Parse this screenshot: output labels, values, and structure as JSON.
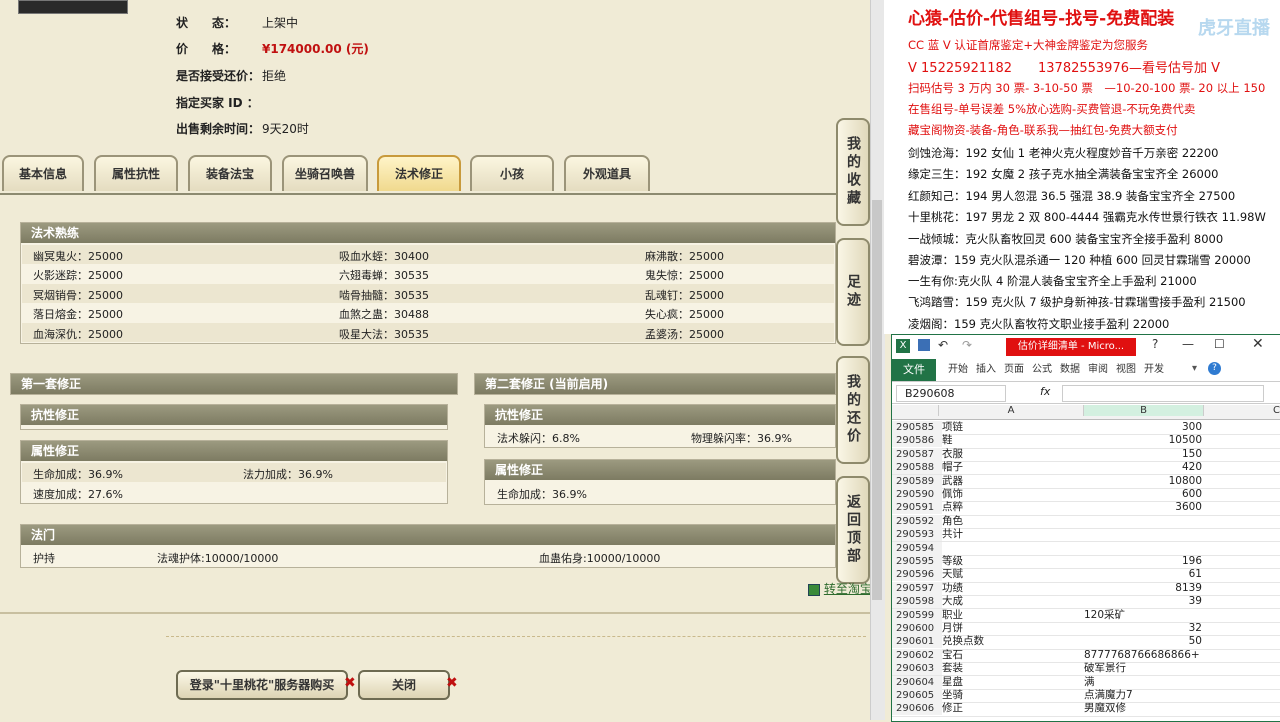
{
  "item": {
    "status_label": "状　　态：",
    "status_value": "上架中",
    "price_label": "价　　格：",
    "price_value": "¥174000.00 (元)",
    "counter_label": "是否接受还价：",
    "counter_value": "拒绝",
    "buyer_label": "指定买家 ID ：",
    "buyer_value": "",
    "time_label": "出售剩余时间：",
    "time_value": "9天20时"
  },
  "tabs": [
    "基本信息",
    "属性抗性",
    "装备法宝",
    "坐骑召唤兽",
    "法术修正",
    "小孩",
    "外观道具"
  ],
  "active_tab": "法术修正",
  "spells": {
    "title": "法术熟练",
    "rows": [
      [
        "幽冥鬼火：25000",
        "吸血水蛭：30400",
        "麻沸散：25000"
      ],
      [
        "火影迷踪：25000",
        "六翅毒蝉：30535",
        "鬼失惊：25000"
      ],
      [
        "冥烟销骨：25000",
        "啮骨抽髓：30535",
        "乱魂钉：25000"
      ],
      [
        "落日熔金：25000",
        "血煞之蛊：30488",
        "失心疯：25000"
      ],
      [
        "血海深仇：25000",
        "吸星大法：30535",
        "孟婆汤：25000"
      ]
    ]
  },
  "set1": {
    "title": "第一套修正",
    "resist_title": "抗性修正",
    "attr_title": "属性修正",
    "attr_rows": [
      [
        "生命加成：36.9%",
        "法力加成：36.9%"
      ],
      [
        "速度加成：27.6%",
        ""
      ]
    ]
  },
  "set2": {
    "title": "第二套修正 (当前启用)",
    "resist_title": "抗性修正",
    "resist_row": [
      "法术躲闪：6.8%",
      "物理躲闪率：36.9%"
    ],
    "attr_title": "属性修正",
    "attr_row": [
      "生命加成：36.9%"
    ]
  },
  "fa_men": {
    "title": "法门",
    "row": [
      "护持",
      "法魂护体:10000/10000",
      "血蛊佑身:10000/10000"
    ]
  },
  "side_buttons": [
    "我的收藏",
    "足迹",
    "我的还价",
    "返回顶部"
  ],
  "side_link": "转至淘宝",
  "buttons": {
    "login": "登录\"十里桃花\"服务器购买",
    "close": "关闭"
  },
  "ad": {
    "headline": "心猿-估价-代售组号-找号-免费配装",
    "watermark": "虎牙直播",
    "red_lines": [
      "CC 蓝 V 认证首席鉴定+大神金牌鉴定为您服务",
      "V 15225921182　　13782553976—看号估号加 V",
      "扫码估号 3 万内 30 票- 3-10-50 票　—10-20-100 票- 20 以上 150",
      "在售组号-单号误差 5%放心选购-买费管退-不玩免费代卖",
      "藏宝阁物资-装备-角色-联系我—抽红包-免费大额支付"
    ],
    "black_lines": [
      "剑蚀沧海：192 女仙 1 老神火克火程度妙音千万亲密 22200",
      "缘定三生：192 女魔 2 孩子克水抽全满装备宝宝齐全 26000",
      "红颜知己：194 男人忽混 36.5 强混 38.9 装备宝宝齐全 27500",
      "十里桃花：197 男龙 2 双 800-4444 强霸克水传世景行铁衣 11.98W",
      "一战倾城：克火队畜牧回灵 600 装备宝宝齐全接手盈利 8000",
      "碧波潭：159 克火队混杀通一 120 种植 600 回灵甘霖瑞雪 20000",
      "一生有你:克火队 4 阶混人装备宝宝齐全上手盈利 21000",
      "飞鸿踏雪：159 克火队 7 级护身新神孩-甘霖瑞雪接手盈利 21500",
      "凌烟阁：159 克火队畜牧符文职业接手盈利 22000"
    ]
  },
  "excel": {
    "title": "估价详细清单 - Micro...",
    "file_tab": "文件",
    "ribbon_tabs": [
      "开始",
      "插入",
      "页面",
      "公式",
      "数据",
      "审阅",
      "视图",
      "开发"
    ],
    "name_box": "B290608",
    "fx": "fx",
    "col_headers": [
      "A",
      "B",
      "C"
    ],
    "rows": [
      {
        "n": "290585",
        "a": "项链",
        "b": "300",
        "num": true
      },
      {
        "n": "290586",
        "a": "鞋",
        "b": "10500",
        "num": true
      },
      {
        "n": "290587",
        "a": "衣服",
        "b": "150",
        "num": true
      },
      {
        "n": "290588",
        "a": "帽子",
        "b": "420",
        "num": true
      },
      {
        "n": "290589",
        "a": "武器",
        "b": "10800",
        "num": true
      },
      {
        "n": "290590",
        "a": "佩饰",
        "b": "600",
        "num": true
      },
      {
        "n": "290591",
        "a": "点粹",
        "b": "3600",
        "num": true
      },
      {
        "n": "290592",
        "a": "角色",
        "b": "",
        "num": true
      },
      {
        "n": "290593",
        "a": "共计",
        "b": "",
        "num": true
      },
      {
        "n": "290594",
        "a": "",
        "b": "",
        "num": true
      },
      {
        "n": "290595",
        "a": "等级",
        "b": "196",
        "num": true
      },
      {
        "n": "290596",
        "a": "天赋",
        "b": "61",
        "num": true
      },
      {
        "n": "290597",
        "a": "功绩",
        "b": "8139",
        "num": true
      },
      {
        "n": "290598",
        "a": "大成",
        "b": "39",
        "num": true
      },
      {
        "n": "290599",
        "a": "职业",
        "b": "120采矿",
        "num": false
      },
      {
        "n": "290600",
        "a": "月饼",
        "b": "32",
        "num": true
      },
      {
        "n": "290601",
        "a": "兑换点数",
        "b": "50",
        "num": true
      },
      {
        "n": "290602",
        "a": "宝石",
        "b": "8777768766686866+",
        "num": false
      },
      {
        "n": "290603",
        "a": "套装",
        "b": "破军景行",
        "num": false
      },
      {
        "n": "290604",
        "a": "星盘",
        "b": "满",
        "num": false
      },
      {
        "n": "290605",
        "a": "坐骑",
        "b": "点满魔力7",
        "num": false
      },
      {
        "n": "290606",
        "a": "修正",
        "b": "男魔双修",
        "num": false
      }
    ]
  }
}
